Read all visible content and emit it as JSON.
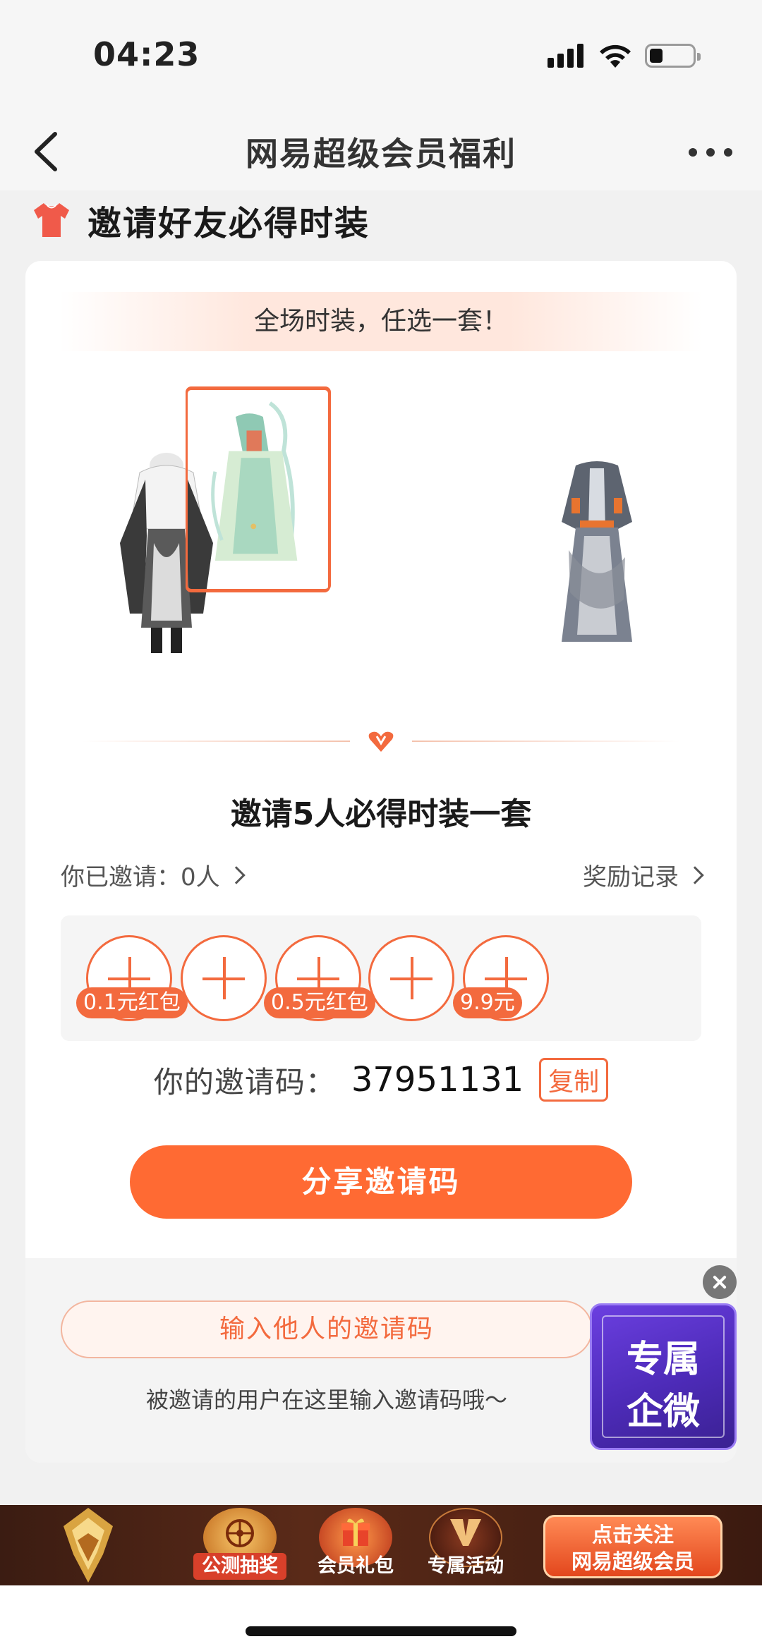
{
  "status_bar": {
    "time": "04:23"
  },
  "nav": {
    "title": "网易超级会员福利"
  },
  "section": {
    "title": "邀请好友必得时装"
  },
  "card": {
    "banner": "全场时装，任选一套！",
    "outfits": [
      {
        "name": "outfit-black-white"
      },
      {
        "name": "outfit-green-selected",
        "selected": true
      },
      {
        "name": "outfit-grey-orange"
      }
    ],
    "invite_title": "邀请5人必得时装一套",
    "invited_label": "你已邀请：0人",
    "records_label": "奖励记录",
    "slots": [
      {
        "badge": "0.1元红包"
      },
      {
        "badge": ""
      },
      {
        "badge": "0.5元红包"
      },
      {
        "badge": ""
      },
      {
        "badge": "9.9元"
      }
    ],
    "code_label": "你的邀请码：",
    "code_value": "37951131",
    "copy_label": "复制",
    "share_label": "分享邀请码",
    "input_code_label": "输入他人的邀请码",
    "hint": "被邀请的用户在这里输入邀请码哦～"
  },
  "float_promo": {
    "line1": "专属",
    "line2": "企微"
  },
  "ad_banner": {
    "items": [
      "公测抽奖",
      "会员礼包",
      "专属活动"
    ],
    "cta_line1": "点击关注",
    "cta_line2": "网易超级会员"
  },
  "colors": {
    "accent": "#ff6a33",
    "accent_border": "#f36a3e",
    "promo_purple": "#5a34cc"
  }
}
